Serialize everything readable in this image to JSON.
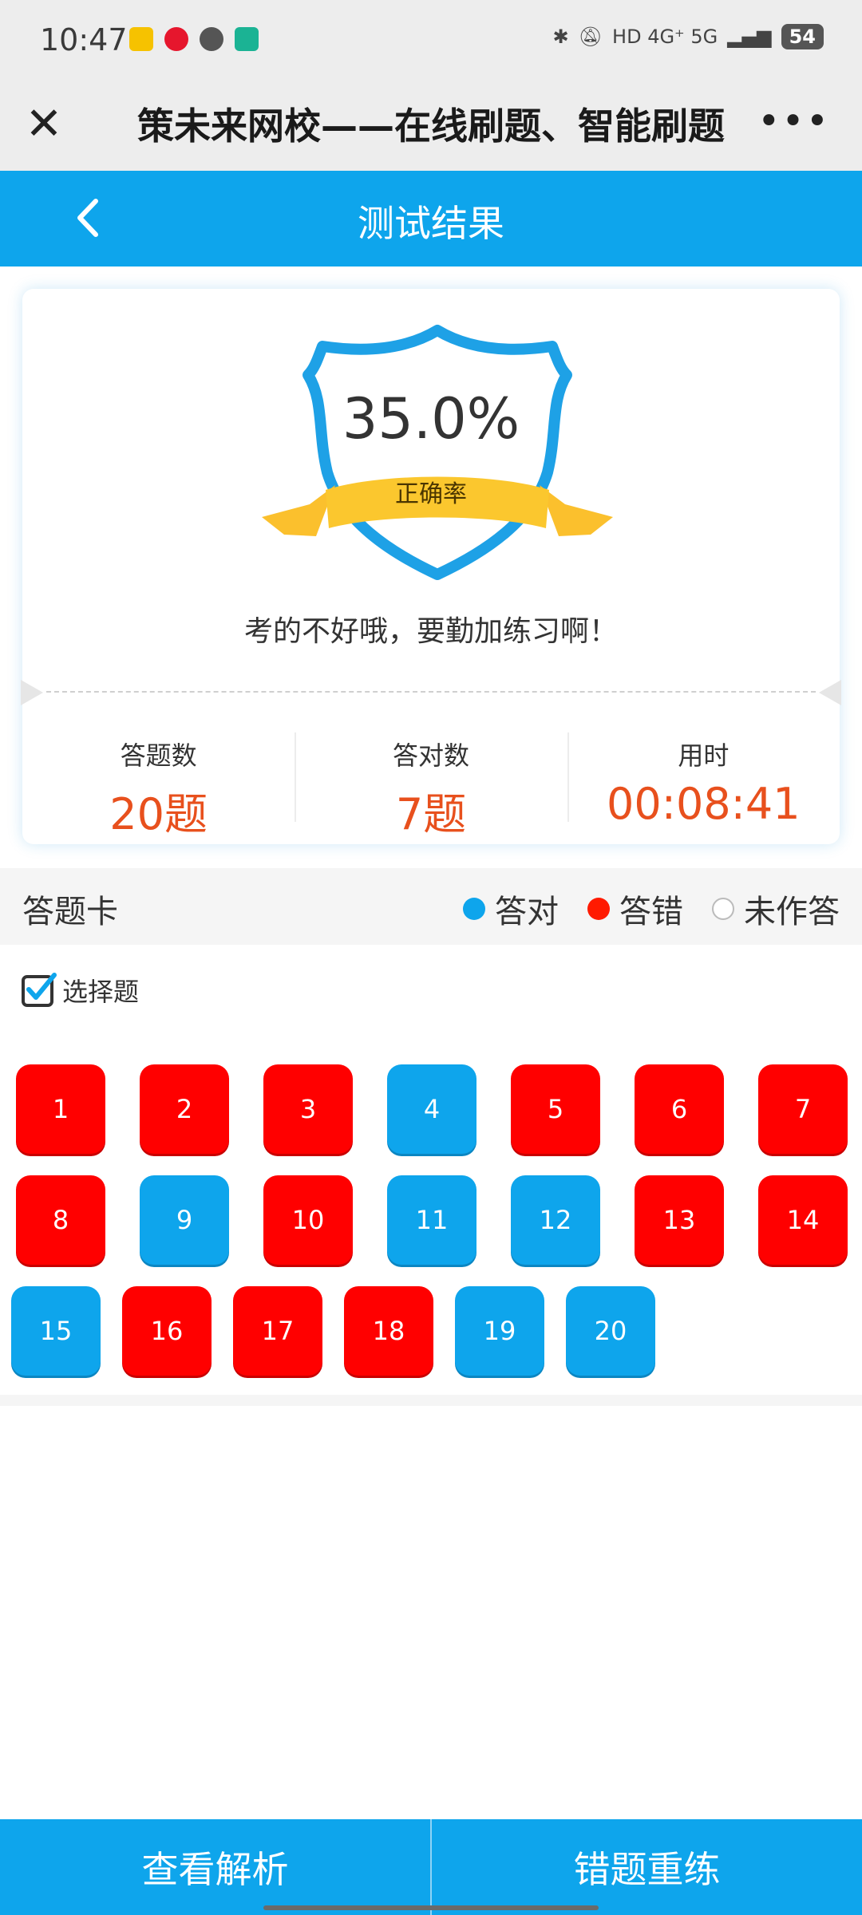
{
  "status_bar": {
    "time": "10:47",
    "network": "HD 4G⁺ 5G",
    "battery": "54"
  },
  "appbar": {
    "title": "策未来网校——在线刷题、智能刷题",
    "close_glyph": "✕",
    "more_glyph": "•••"
  },
  "nav": {
    "title": "测试结果"
  },
  "result": {
    "rate": "35.0%",
    "rate_label": "正确率",
    "message": "考的不好哦，要勤加练习啊！"
  },
  "stats": [
    {
      "label": "答题数",
      "value": "20题"
    },
    {
      "label": "答对数",
      "value": "7题"
    },
    {
      "label": "用时",
      "value": "00:08:41"
    }
  ],
  "sheet": {
    "title": "答题卡",
    "legend": [
      {
        "label": "答对",
        "color": "#0ea5ec"
      },
      {
        "label": "答错",
        "color": "#ff1a00"
      },
      {
        "label": "未作答",
        "color": "#ffffff"
      }
    ],
    "category": "选择题"
  },
  "questions": [
    {
      "n": "1",
      "s": "wrong"
    },
    {
      "n": "2",
      "s": "wrong"
    },
    {
      "n": "3",
      "s": "wrong"
    },
    {
      "n": "4",
      "s": "correct"
    },
    {
      "n": "5",
      "s": "wrong"
    },
    {
      "n": "6",
      "s": "wrong"
    },
    {
      "n": "7",
      "s": "wrong"
    },
    {
      "n": "8",
      "s": "wrong"
    },
    {
      "n": "9",
      "s": "correct"
    },
    {
      "n": "10",
      "s": "wrong"
    },
    {
      "n": "11",
      "s": "correct"
    },
    {
      "n": "12",
      "s": "correct"
    },
    {
      "n": "13",
      "s": "wrong"
    },
    {
      "n": "14",
      "s": "wrong"
    },
    {
      "n": "15",
      "s": "correct"
    },
    {
      "n": "16",
      "s": "wrong"
    },
    {
      "n": "17",
      "s": "wrong"
    },
    {
      "n": "18",
      "s": "wrong"
    },
    {
      "n": "19",
      "s": "correct"
    },
    {
      "n": "20",
      "s": "correct"
    }
  ],
  "bottom": {
    "analysis": "查看解析",
    "retry": "错题重练"
  },
  "colors": {
    "accent": "#0ea5ec",
    "wrong": "#ff0000",
    "stat_value": "#e8501d",
    "ribbon": "#fbc02d"
  }
}
